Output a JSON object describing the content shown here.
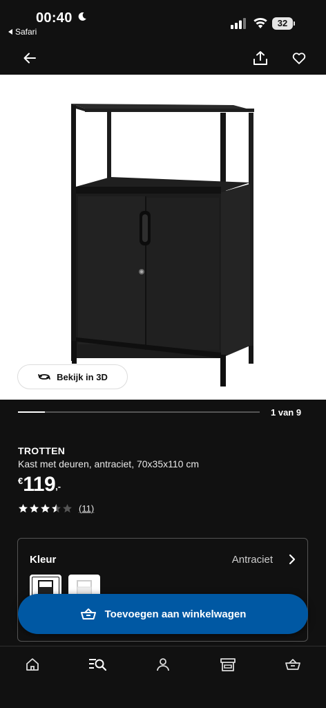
{
  "status": {
    "time": "00:40",
    "back_app": "Safari",
    "battery": "32"
  },
  "nav": {
    "back_icon": "arrow-left-icon",
    "share_icon": "share-icon",
    "favorite_icon": "heart-icon"
  },
  "image": {
    "view_3d_label": "Bekijk in 3D"
  },
  "pager": {
    "label": "1 van 9",
    "progress": 0.11
  },
  "product": {
    "name": "TROTTEN",
    "description": "Kast met deuren, antraciet, 70x35x110 cm",
    "currency": "€",
    "price": "119",
    "price_decimals": ",-",
    "rating": 3.5,
    "review_count": "(11)"
  },
  "color": {
    "label": "Kleur",
    "value": "Antraciet",
    "swatches": [
      "Antraciet",
      "Wit"
    ]
  },
  "cta": {
    "label": "Toevoegen aan winkelwagen"
  },
  "bottom_nav": {
    "items": [
      {
        "icon": "home-icon"
      },
      {
        "icon": "search-list-icon"
      },
      {
        "icon": "profile-icon"
      },
      {
        "icon": "store-icon"
      },
      {
        "icon": "basket-icon"
      }
    ]
  },
  "colors": {
    "accent": "#0058a3",
    "background": "#111111"
  }
}
